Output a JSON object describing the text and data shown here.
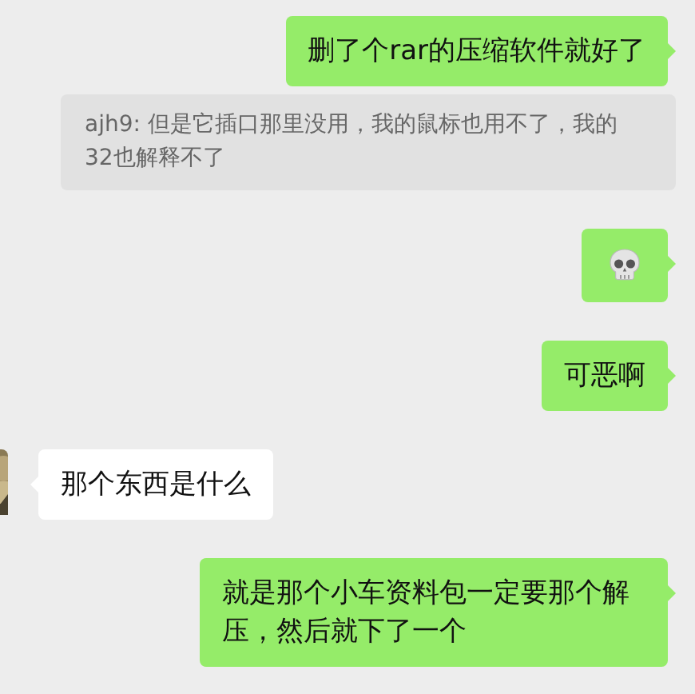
{
  "messages": [
    {
      "outgoing": true,
      "kind": "text",
      "text": "删了个rar的压缩软件就好了",
      "quote": "ajh9: 但是它插口那里没用，我的鼠标也用不了，我的32也解释不了"
    },
    {
      "outgoing": true,
      "kind": "emoji"
    },
    {
      "outgoing": true,
      "kind": "text",
      "text": "可恶啊"
    },
    {
      "outgoing": false,
      "kind": "text",
      "text": "那个东西是什么"
    },
    {
      "outgoing": true,
      "kind": "text",
      "text": "就是那个小车资料包一定要那个解压，然后就下了一个"
    }
  ]
}
